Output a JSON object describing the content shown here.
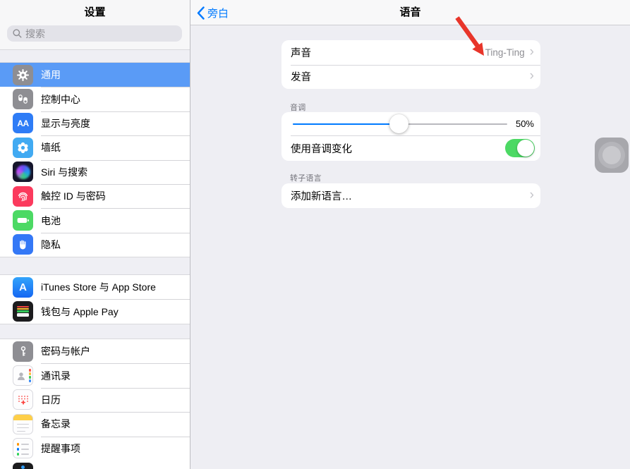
{
  "sidebar": {
    "title": "设置",
    "search_placeholder": "搜索",
    "items": [
      {
        "label": "通用",
        "icon": "gear",
        "selected": true
      },
      {
        "label": "控制中心",
        "icon": "control-center"
      },
      {
        "label": "显示与亮度",
        "icon": "display-brightness"
      },
      {
        "label": "墙纸",
        "icon": "wallpaper"
      },
      {
        "label": "Siri 与搜索",
        "icon": "siri"
      },
      {
        "label": "触控 ID 与密码",
        "icon": "touch-id"
      },
      {
        "label": "电池",
        "icon": "battery"
      },
      {
        "label": "隐私",
        "icon": "privacy-hand"
      },
      {
        "label": "iTunes Store 与 App Store",
        "icon": "app-store"
      },
      {
        "label": "钱包与 Apple Pay",
        "icon": "wallet"
      },
      {
        "label": "密码与帐户",
        "icon": "passwords-key"
      },
      {
        "label": "通讯录",
        "icon": "contacts"
      },
      {
        "label": "日历",
        "icon": "calendar"
      },
      {
        "label": "备忘录",
        "icon": "notes"
      },
      {
        "label": "提醒事项",
        "icon": "reminders"
      }
    ],
    "display_icon_text": "AA",
    "appstore_icon_text": "A"
  },
  "nav": {
    "back_label": "旁白",
    "title": "语音"
  },
  "voice_settings": {
    "voice_row": {
      "label": "声音",
      "value": "Ting-Ting"
    },
    "pronunciation_row": {
      "label": "发音"
    },
    "pitch": {
      "section_header": "音调",
      "slider_percent": 49.5,
      "slider_value_label": "50%",
      "toggle_label": "使用音调变化",
      "toggle_on": true
    },
    "rotor": {
      "section_header": "转子语言",
      "add_language_label": "添加新语言…"
    }
  },
  "colors": {
    "accent_blue": "#007aff",
    "selected_row_blue": "#5a9bf6",
    "toggle_green": "#4cd964",
    "annotation_arrow_red": "#e8352a",
    "grouped_background": "#eeeef3"
  }
}
